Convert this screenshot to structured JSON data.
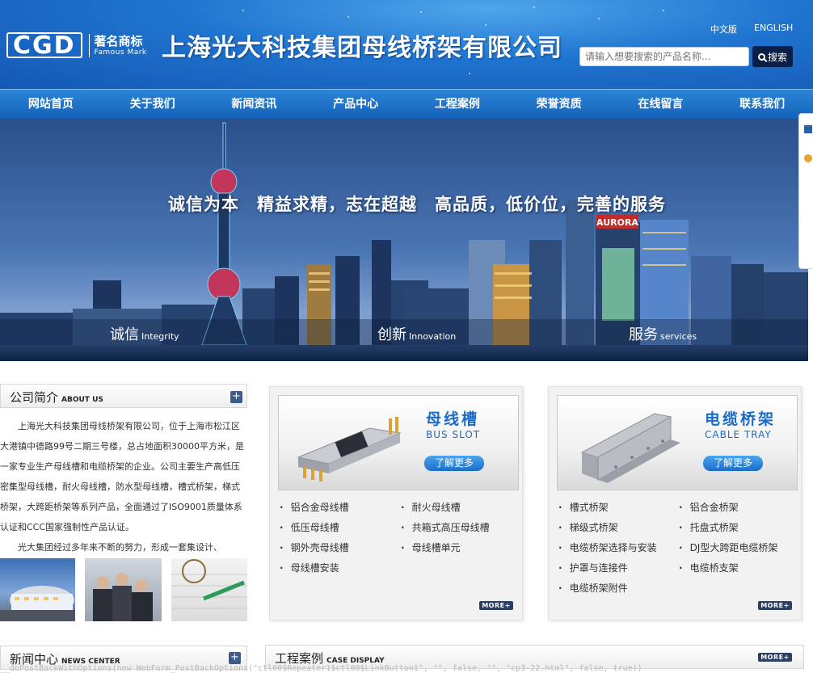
{
  "header": {
    "logo_letters": "CGD",
    "logo_mark_cn": "著名商标",
    "logo_mark_en": "Famous Mark",
    "company_name": "上海光大科技集团母线桥架有限公司",
    "lang_cn": "中文版",
    "lang_en": "ENGLISH",
    "search_placeholder": "请输入想要搜索的产品名称...",
    "search_button": "搜索"
  },
  "nav": {
    "items": [
      "网站首页",
      "关于我们",
      "新闻资讯",
      "产品中心",
      "工程案例",
      "荣誉资质",
      "在线留言",
      "联系我们"
    ]
  },
  "banner": {
    "slogan": "诚信为本　精益求精，志在超越　高品质，低价位，完善的服务",
    "sign": "AURORA",
    "values": [
      {
        "cn": "诚信",
        "en": "Integrity"
      },
      {
        "cn": "创新",
        "en": "Innovation"
      },
      {
        "cn": "服务",
        "en": "services"
      }
    ]
  },
  "about": {
    "title_cn": "公司简介",
    "title_en": "ABOUT US",
    "plus": "+",
    "para1": "上海光大科技集团母线桥架有限公司，位于上海市松江区大港镇中德路99号二期三号楼，总占地面积30000平方米，是一家专业生产母线槽和电缆桥架的企业。公司主要生产高低压密集型母线槽，耐火母线槽，防水型母线槽，槽式桥架，梯式桥架，大跨距桥架等系列产品，全面通过了ISO9001质量体系认证和CCC国家强制性产品认证。",
    "para2": "光大集团经过多年来不断的努力，形成一套集设计、"
  },
  "products": [
    {
      "title_cn": "母线槽",
      "title_en": "BUS SLOT",
      "more_pill": "了解更多",
      "items": [
        "铝合金母线槽",
        "耐火母线槽",
        "低压母线槽",
        "共箱式高压母线槽",
        "钢外壳母线槽",
        "母线槽单元",
        "母线槽安装"
      ],
      "more_tag": "MORE+"
    },
    {
      "title_cn": "电缆桥架",
      "title_en": "CABLE TRAY",
      "more_pill": "了解更多",
      "items": [
        "槽式桥架",
        "铝合金桥架",
        "梯级式桥架",
        "托盘式桥架",
        "电缆桥架选择与安装",
        "DJ型大跨距电缆桥架",
        "护罩与连接件",
        "电缆桥支架",
        "电缆桥架附件"
      ],
      "more_tag": "MORE+"
    }
  ],
  "news": {
    "title_cn": "新闻中心",
    "title_en": "NEWS CENTER",
    "plus": "+"
  },
  "cases": {
    "title_cn": "工程案例",
    "title_en": "CASE DISPLAY",
    "more_tag": "MORE+"
  },
  "status_bar": "__doPostBackWithOptions(new WebForm_PostBackOptions(\"ctl00$Repeater1$ctl00$LinkButton1\", \"\", false, \"\", \"cp3-22.html\", false, true))"
}
